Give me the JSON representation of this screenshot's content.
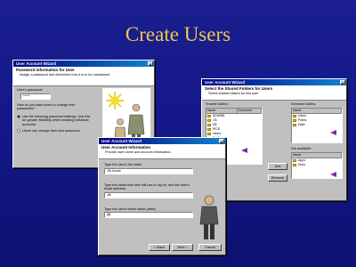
{
  "slide": {
    "title": "Create Users"
  },
  "dialog1": {
    "title": "User Account Wizard",
    "heading": "Password Information for User",
    "subheading": "Assign a password and determine how it is to be maintained.",
    "password_label": "User's password:",
    "password_value": "*****",
    "question": "How do you want users to change their passwords?",
    "option1": "Use the following password settings. Use this for greater flexibility when creating individual accounts.",
    "option2": "Users can change their own password."
  },
  "dialog2": {
    "title": "User Account Wizard",
    "heading": "Select the Shared Folders for Users",
    "subheading": "Select shared folders for this user.",
    "list_label": "Shared folders:",
    "columns": [
      "Name",
      "Comment"
    ],
    "folders": [
      "ADMIN$",
      "C$",
      "D$",
      "IPC$",
      "Users",
      "Public",
      "Data"
    ],
    "buttons": [
      "Add",
      "Remove"
    ],
    "right_label": "Selected folders:",
    "right_items": [
      "Users",
      "Public",
      "Data"
    ],
    "right_label2": "Not available:",
    "right_items2": [
      "Apps",
      "Docs"
    ]
  },
  "dialog3": {
    "title": "User Account Wizard",
    "heading": "User Account Information",
    "subheading": "Provide user name and account information.",
    "label1": "Type the user's full name.",
    "value1": "Jill Jones",
    "label2": "Type the name that user will use to log on, and the user's email address.",
    "value2": "Jill",
    "label3": "Type the user's email name (alias).",
    "value3": "jillj",
    "buttons": [
      "< Back",
      "Next >",
      "Cancel"
    ]
  }
}
